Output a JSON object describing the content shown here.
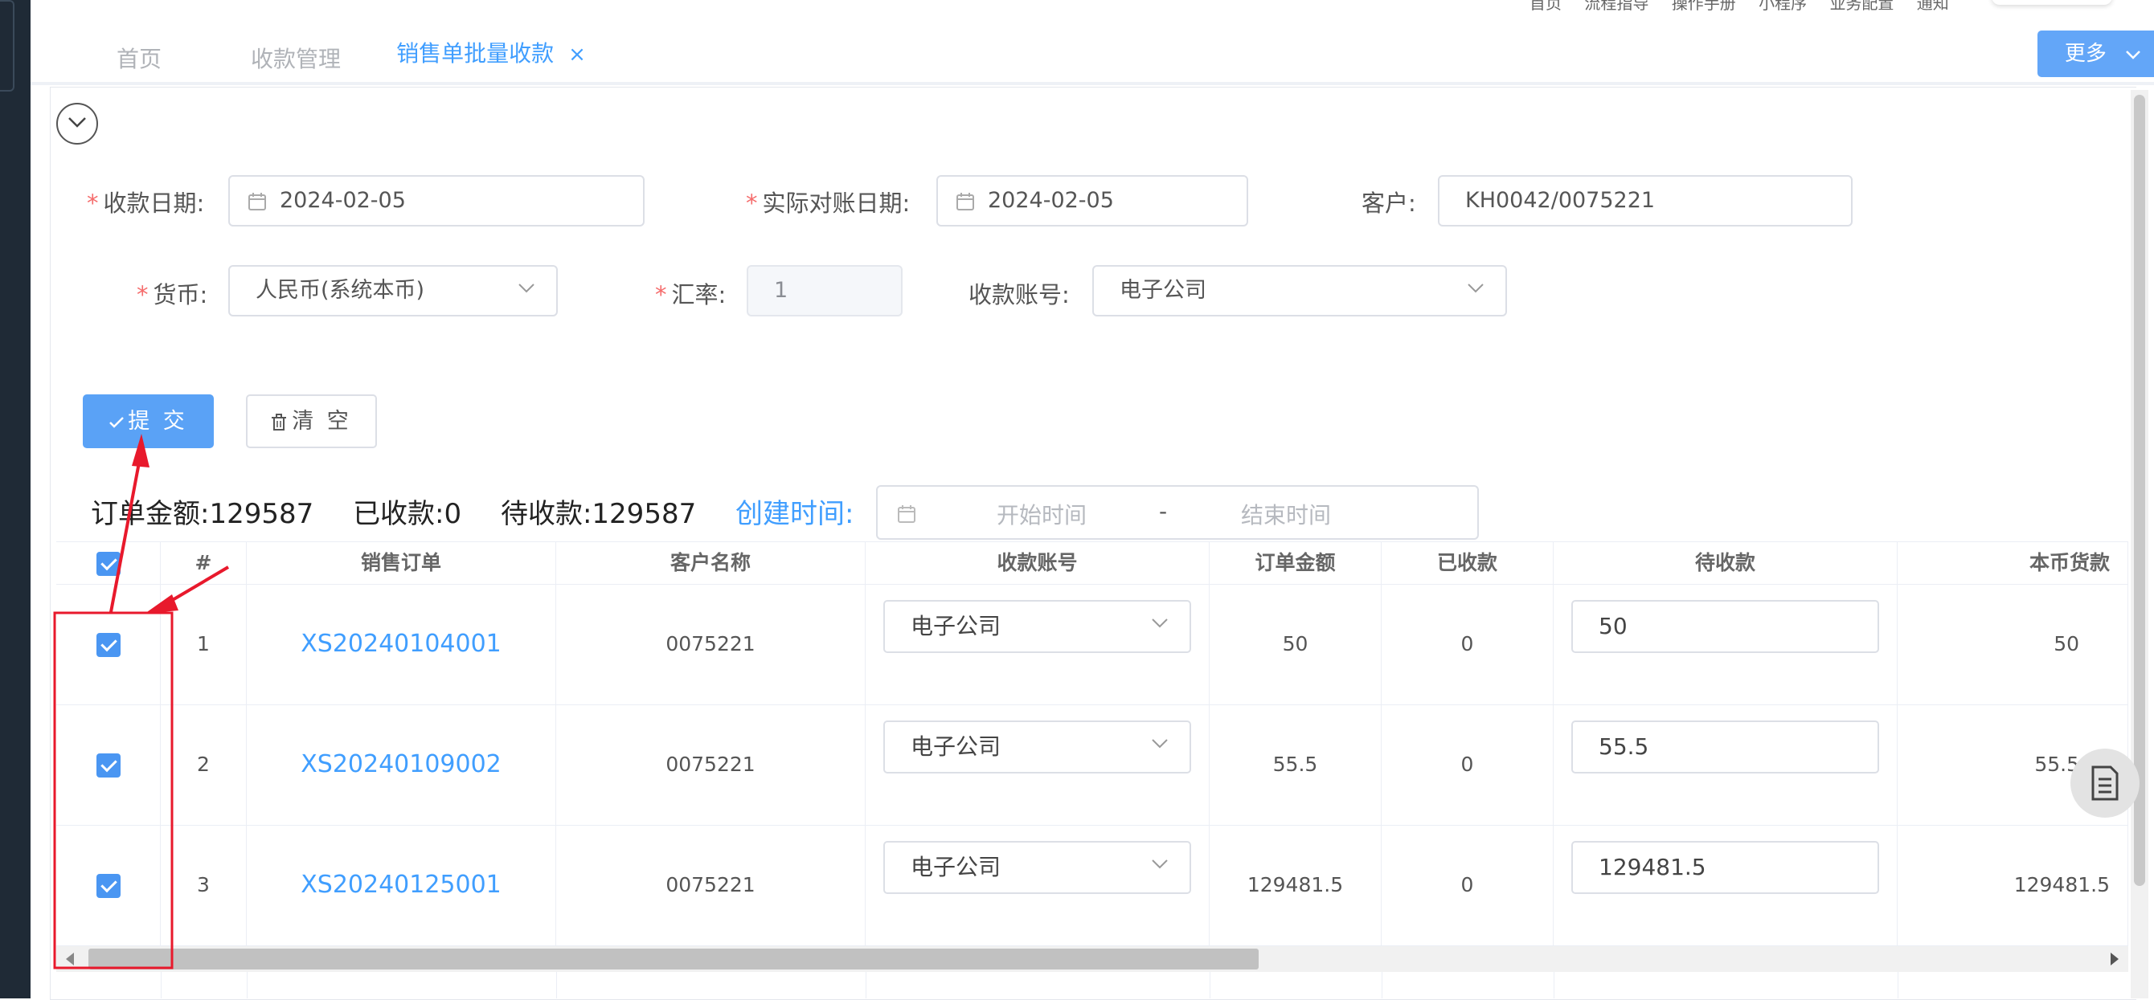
{
  "topnav": {
    "links": [
      "首页",
      "流程指导",
      "操作手册",
      "小程序",
      "业务配置",
      "通知"
    ]
  },
  "tabs": {
    "home": "首页",
    "mgmt": "收款管理",
    "active": "销售单批量收款",
    "close": "×",
    "more": "更多"
  },
  "form": {
    "receipt_date_label": "收款日期:",
    "receipt_date": "2024-02-05",
    "recon_date_label": "实际对账日期:",
    "recon_date": "2024-02-05",
    "customer_label": "客户:",
    "customer": "KH0042/0075221",
    "currency_label": "货币:",
    "currency": "人民币(系统本币)",
    "rate_label": "汇率:",
    "rate": "1",
    "account_label": "收款账号:",
    "account": "电子公司",
    "required_mark": "*"
  },
  "actions": {
    "submit": "提 交",
    "clear": "清 空"
  },
  "summary": {
    "order_amount": "订单金额:129587",
    "received": "已收款:0",
    "pending": "待收款:129587",
    "created_label": "创建时间:",
    "start_placeholder": "开始时间",
    "dash": "-",
    "end_placeholder": "结束时间"
  },
  "table": {
    "headers": [
      "#",
      "销售订单",
      "客户名称",
      "收款账号",
      "订单金额",
      "已收款",
      "待收款",
      "本币货款"
    ],
    "rows": [
      {
        "idx": "1",
        "order": "XS20240104001",
        "customer": "0075221",
        "account": "电子公司",
        "amount": "50",
        "received": "0",
        "pending": "50",
        "local": "50"
      },
      {
        "idx": "2",
        "order": "XS20240109002",
        "customer": "0075221",
        "account": "电子公司",
        "amount": "55.5",
        "received": "0",
        "pending": "55.5",
        "local": "55.5"
      },
      {
        "idx": "3",
        "order": "XS20240125001",
        "customer": "0075221",
        "account": "电子公司",
        "amount": "129481.5",
        "received": "0",
        "pending": "129481.5",
        "local": "129481.5"
      }
    ]
  },
  "colors": {
    "primary": "#409eff",
    "button": "#5aa2f6",
    "annotation": "#e8192c",
    "required": "#f56c6c"
  },
  "icons": [
    "chevron-down-icon",
    "calendar-icon",
    "check-icon",
    "trash-icon",
    "document-icon"
  ]
}
